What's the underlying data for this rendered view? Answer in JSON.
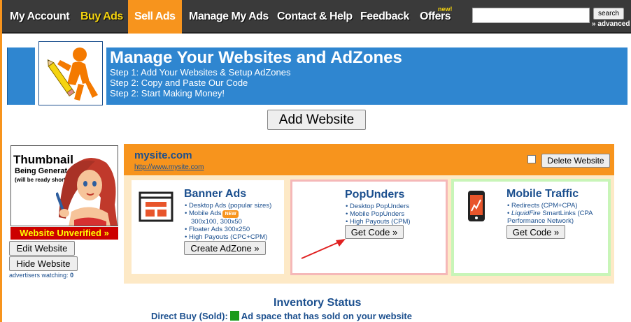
{
  "nav": {
    "items": [
      "My Account",
      "Buy Ads",
      "Sell Ads",
      "Manage My Ads",
      "Contact & Help",
      "Feedback",
      "Offers"
    ],
    "new_badge": "new!",
    "search_button": "search",
    "search_placeholder": "",
    "advanced": "» advanced"
  },
  "banner": {
    "title": "Manage Your Websites and AdZones",
    "steps": [
      "Step 1: Add Your Websites & Setup AdZones",
      "Step 2: Copy and Paste Our Code",
      "Step 2: Start Making Money!"
    ]
  },
  "add_website": "Add Website",
  "thumbnail": {
    "title": "Thumbnail",
    "subtitle": "Being Generated",
    "note": "(will be ready shortly)"
  },
  "unverified": "Website Unverified »",
  "edit_website": "Edit Website",
  "hide_website": "Hide Website",
  "watching_label": "advertisers watching:",
  "watching_count": "0",
  "site": {
    "name": "mysite.com",
    "url": "http://www.mysite.com",
    "delete": "Delete Website"
  },
  "cards": {
    "banner": {
      "title": "Banner Ads",
      "items": [
        "Desktop Ads (popular sizes)",
        "Mobile Ads",
        "300x100, 300x50",
        "Floater Ads 300x250",
        "High Payouts (CPC+CPM)"
      ],
      "new_badge": "NEW",
      "button": "Create AdZone »"
    },
    "popunders": {
      "title": "PopUnders",
      "items": [
        "Desktop PopUnders",
        "Mobile PopUnders",
        "High Payouts (CPM)"
      ],
      "button": "Get Code »"
    },
    "mobile": {
      "title": "Mobile Traffic",
      "items": [
        "Redirects (CPM+CPA)",
        "LiquidFire",
        "SmartLinks (CPA",
        "Performance Network)"
      ],
      "button": "Get Code »"
    }
  },
  "inventory": {
    "title": "Inventory Status",
    "label": "Direct Buy (Sold):",
    "desc": "Ad space that has sold on your website",
    "swatch_color": "#1a9a1a"
  },
  "colors": {
    "accent": "#f7941d",
    "banner_blue": "#2f86d0",
    "link_blue": "#1b4f8e"
  }
}
